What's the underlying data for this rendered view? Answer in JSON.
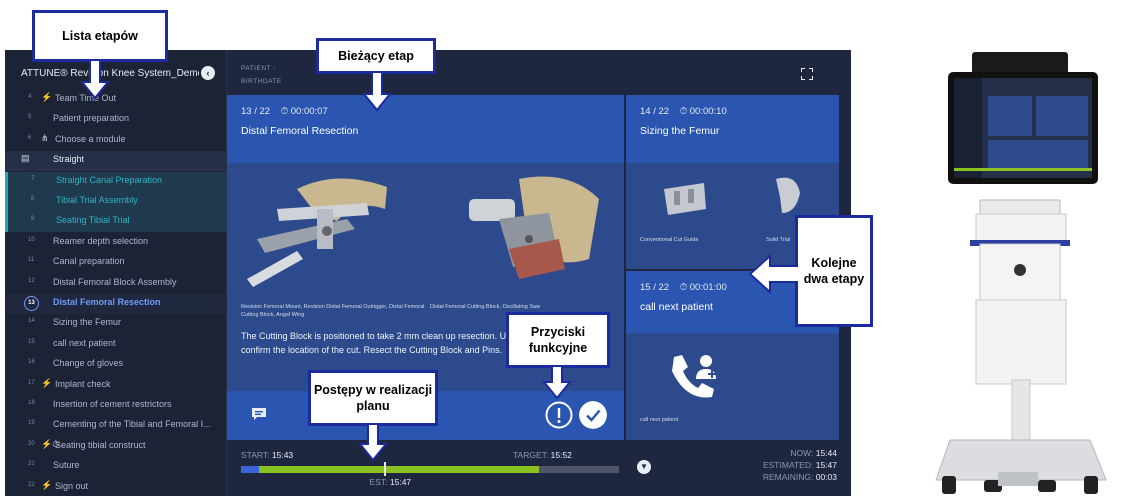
{
  "sidebar": {
    "title": "ATTUNE® Revision Knee System_Demo ...",
    "collapse_glyph": "‹",
    "steps": [
      {
        "num": "4",
        "label": "Team Time Out",
        "glyph": "⚡"
      },
      {
        "num": "5",
        "label": "Patient preparation",
        "glyph": ""
      },
      {
        "num": "6",
        "label": "Choose a module",
        "glyph": "⋔"
      },
      {
        "num": "",
        "label": "Straight",
        "glyph": "▤"
      },
      {
        "num": "7",
        "label": "Straight Canal Preparation",
        "glyph": ""
      },
      {
        "num": "8",
        "label": "Tibial Trial Assembly",
        "glyph": ""
      },
      {
        "num": "9",
        "label": "Seating Tibial Trial",
        "glyph": ""
      },
      {
        "num": "10",
        "label": "Reamer depth selection",
        "glyph": ""
      },
      {
        "num": "11",
        "label": "Canal preparation",
        "glyph": ""
      },
      {
        "num": "12",
        "label": "Distal Femoral Block Assembly",
        "glyph": ""
      },
      {
        "num": "13",
        "label": "Distal Femoral Resection",
        "glyph": ""
      },
      {
        "num": "14",
        "label": "Sizing the Femur",
        "glyph": ""
      },
      {
        "num": "15",
        "label": "call next patient",
        "glyph": ""
      },
      {
        "num": "16",
        "label": "Change of gloves",
        "glyph": ""
      },
      {
        "num": "17",
        "label": "Implant check",
        "glyph": "⚡"
      },
      {
        "num": "18",
        "label": "Insertion of cement restrictors",
        "glyph": ""
      },
      {
        "num": "19",
        "label": "Cementing of the Tibial and Femoral I...",
        "glyph": ""
      },
      {
        "num": "20",
        "label": "Seating tibial construct",
        "glyph": "⚡⏱"
      },
      {
        "num": "21",
        "label": "Suture",
        "glyph": ""
      },
      {
        "num": "22",
        "label": "Sign out",
        "glyph": "⚡"
      }
    ]
  },
  "header": {
    "patient_label": "PATIENT -",
    "birthdate_label": "BIRTHDATE"
  },
  "current": {
    "counter": "13 / 22",
    "timer": "00:00:07",
    "title": "Distal Femoral Resection",
    "caption_left": "Revision Femoral Mount, Revision Distal Femoral Outrigger, Distal Femoral Cutting Block, Angel Wing",
    "caption_right": "Distal Femoral Cutting Block, Oscillating Saw",
    "description": "The Cutting Block is positioned to take 2 mm clean up resection. Use an Angel Wing to confirm the location of the cut. Resect the Cutting Block and Pins."
  },
  "next": [
    {
      "counter": "14 / 22",
      "timer": "00:00:10",
      "title": "Sizing the Femur",
      "cap1": "Conventional Cut Guide",
      "cap2": "Solid Trial"
    },
    {
      "counter": "15 / 22",
      "timer": "00:01:00",
      "title": "call next patient",
      "cap1": "call next patient"
    }
  ],
  "progress": {
    "start_label": "START:",
    "start": "15:43",
    "target_label": "TARGET:",
    "target": "15:52",
    "est_label": "EST:",
    "est": "15:47",
    "now_label": "NOW:",
    "now": "15:44",
    "estimated_label": "ESTIMATED:",
    "estimated": "15:47",
    "remaining_label": "REMAINING:",
    "remaining": "00:03",
    "completed_fraction": 0.81,
    "est_marker_fraction": 0.36
  },
  "callouts": {
    "steps_list": "Lista etapów",
    "current_step": "Bieżący etap",
    "next_steps": "Kolejne dwa etapy",
    "function_buttons": "Przyciski funkcyjne",
    "progress": "Postępy w realizacji planu"
  },
  "colors": {
    "accent": "#2a55b0",
    "progress_done": "#8ac221",
    "callout_border": "#1c2aa0",
    "highlight": "#24a5b8"
  }
}
